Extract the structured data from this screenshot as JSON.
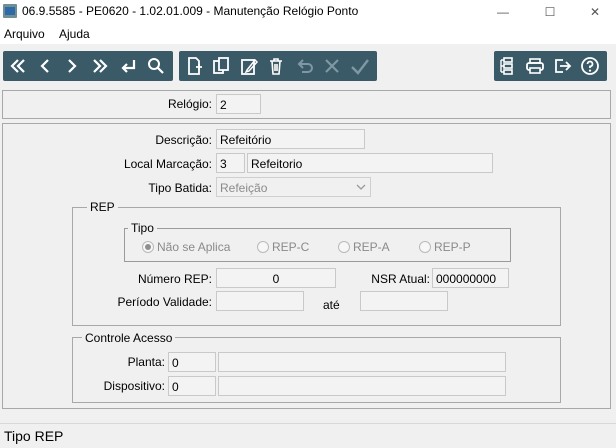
{
  "window": {
    "title": "06.9.5585 - PE0620 - 1.02.01.009 - Manutenção Relógio Ponto",
    "minimize": "—",
    "maximize": "☐",
    "close": "✕"
  },
  "menu": {
    "items": [
      "Arquivo",
      "Ajuda"
    ]
  },
  "toolbar": {
    "nav_icons": [
      "first-icon",
      "previous-icon",
      "next-icon",
      "last-icon",
      "return-icon",
      "search-icon"
    ],
    "edit_icons": [
      "new-icon",
      "copy-icon",
      "edit-icon",
      "delete-icon",
      "undo-icon",
      "cancel-icon",
      "confirm-icon"
    ],
    "util_icons": [
      "tree-icon",
      "print-icon",
      "exit-icon",
      "help-icon"
    ]
  },
  "header": {
    "relogio_label": "Relógio:",
    "relogio_value": "2"
  },
  "form": {
    "descricao_label": "Descrição:",
    "descricao_value": "Refeitório",
    "local_label": "Local Marcação:",
    "local_code": "3",
    "local_name": "Refeitorio",
    "tipo_batida_label": "Tipo Batida:",
    "tipo_batida_value": "Refeição",
    "rep": {
      "title": "REP",
      "tipo_title": "Tipo",
      "tipo_options": [
        "Não se Aplica",
        "REP-C",
        "REP-A",
        "REP-P"
      ],
      "tipo_selected": "Não se Aplica",
      "numero_label": "Número REP:",
      "numero_value": "0",
      "nsr_label": "NSR Atual:",
      "nsr_value": "000000000",
      "periodo_label": "Período Validade:",
      "periodo_from": "",
      "ate_label": "até",
      "periodo_to": ""
    },
    "controle": {
      "title": "Controle Acesso",
      "planta_label": "Planta:",
      "planta_value": "0",
      "planta_desc": "",
      "dispositivo_label": "Dispositivo:",
      "dispositivo_value": "0",
      "dispositivo_desc": ""
    }
  },
  "status": {
    "text": "Tipo REP"
  }
}
